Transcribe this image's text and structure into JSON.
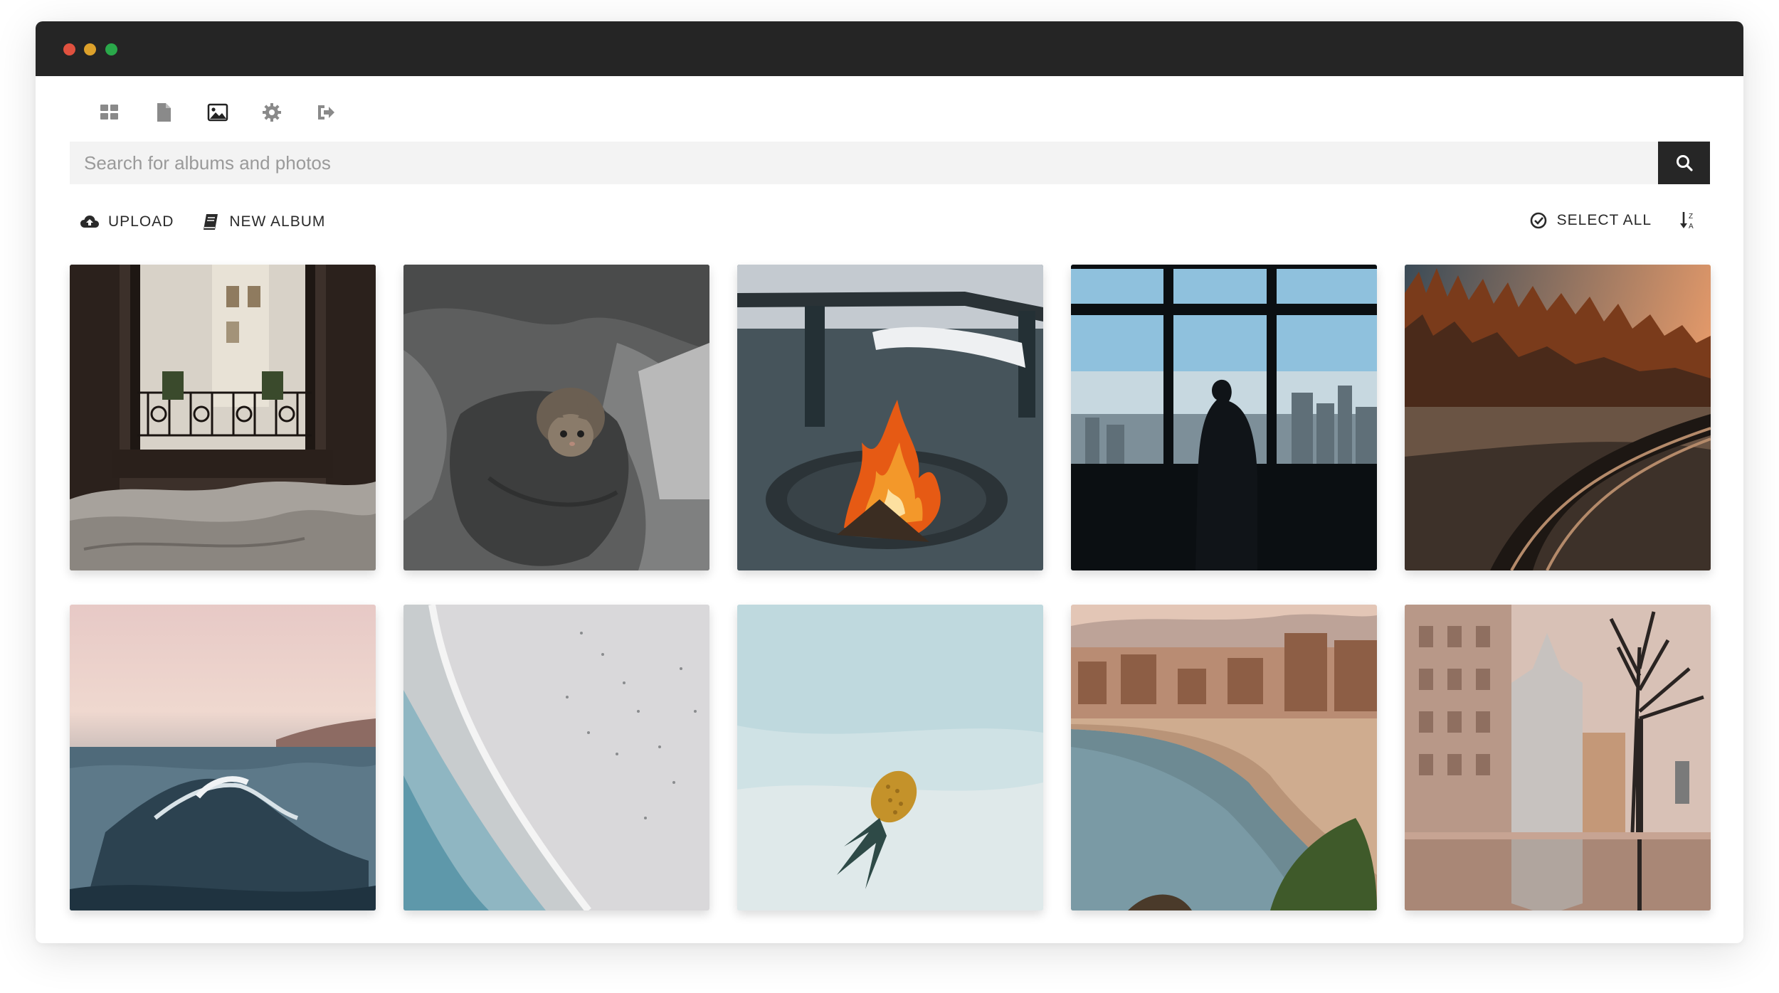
{
  "window": {
    "controls": [
      "close",
      "minimize",
      "maximize"
    ],
    "control_colors": [
      "#e0513f",
      "#dda12b",
      "#2aa84a"
    ]
  },
  "nav": {
    "items": [
      {
        "name": "dashboard-icon"
      },
      {
        "name": "document-icon"
      },
      {
        "name": "image-icon",
        "active": true
      },
      {
        "name": "gear-icon"
      },
      {
        "name": "sign-out-icon"
      }
    ]
  },
  "search": {
    "placeholder": "Search for albums and photos",
    "value": "",
    "button_icon": "search-icon"
  },
  "actions": {
    "upload_label": "UPLOAD",
    "new_album_label": "NEW ALBUM",
    "select_all_label": "SELECT ALL",
    "sort_icon": "sort-alpha-desc-icon"
  },
  "photos": [
    {
      "subject": "bedroom window with balcony"
    },
    {
      "subject": "kitten on grey blanket"
    },
    {
      "subject": "campfire by bench"
    },
    {
      "subject": "silhouette at city window"
    },
    {
      "subject": "railway through autumn forest"
    },
    {
      "subject": "ocean wave at sunset"
    },
    {
      "subject": "aerial beach shoreline"
    },
    {
      "subject": "pineapple in shallow water"
    },
    {
      "subject": "crowded city beach"
    },
    {
      "subject": "street with bare tree and reflection"
    }
  ],
  "colors": {
    "titlebar": "#252525",
    "accent": "#262626",
    "search_bg": "#f3f3f3"
  }
}
